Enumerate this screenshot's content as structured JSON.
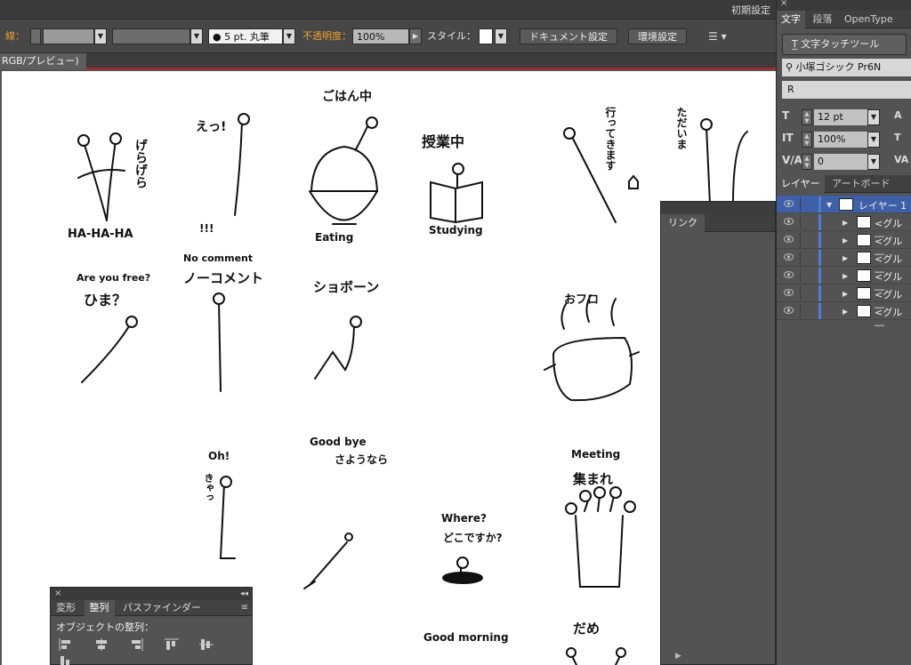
{
  "app": {
    "workspace_label": "初期設定"
  },
  "control_bar": {
    "stroke_label": "線：",
    "brush_label": "5 pt. 丸筆",
    "opacity_label": "不透明度：",
    "opacity_value": "100%",
    "style_label": "スタイル：",
    "document_setup_button": "ドキュメント設定",
    "preferences_button": "環境設定"
  },
  "document_tab": {
    "title": "RGB/プレビュー)"
  },
  "artwork_texts": [
    "げらげら",
    "HA-HA-HA",
    "えっ!",
    "!!!",
    "ごはん中",
    "Eating",
    "授業中",
    "Studying",
    "行ってきます",
    "ただいま",
    "Are you free?",
    "ひま？",
    "No comment",
    "ノーコメント",
    "ショボーン",
    "おフロ",
    "Oh!",
    "きゃっ",
    "Good bye",
    "さようなら",
    "Where?",
    "どこですか?",
    "Meeting",
    "集まれ",
    "Good morning",
    "だめ"
  ],
  "links_panel": {
    "tab_label": "リンク"
  },
  "align_panel": {
    "tabs": [
      "変形",
      "整列",
      "パスファインダー"
    ],
    "active_tab": "整列",
    "section_title": "オブジェクトの整列："
  },
  "character_panel": {
    "tabs": [
      "文字",
      "段落",
      "OpenType"
    ],
    "active_tab": "文字",
    "touch_type_button": "文字タッチツール",
    "font_family": "小塚ゴシック Pr6N",
    "font_style": "R",
    "font_size": "12 pt",
    "vertical_scale": "100%",
    "tracking": "0"
  },
  "layers_panel": {
    "tabs": [
      "レイヤー",
      "アートボード"
    ],
    "active_tab": "レイヤー",
    "layers": [
      {
        "name": "レイヤー 1"
      },
      {
        "name": "<グル―"
      },
      {
        "name": "<グル―"
      },
      {
        "name": "<グル―"
      },
      {
        "name": "<グル―"
      },
      {
        "name": "<グル―"
      },
      {
        "name": "<グル―"
      }
    ]
  },
  "colors": {
    "accent_label": "#f0a030",
    "layer_selection": "#3f5fa8",
    "layer_color_bar": "#4f7cd6",
    "doc_tab_border": "#b02020"
  }
}
